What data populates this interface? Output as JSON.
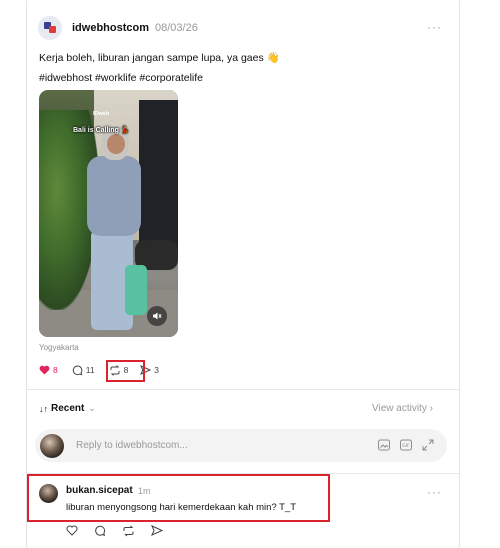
{
  "post": {
    "username": "idwebhostcom",
    "date": "08/03/26",
    "more_label": "···",
    "text_line1": "Kerja boleh, liburan jangan sampe lupa, ya gaes",
    "wave_emoji": "👋",
    "hashtags": "#idwebhost #worklife #corporatelife",
    "video": {
      "brand_watermark": "IDweb",
      "caption": "Bali is Calling 💃"
    },
    "location": "Yogyakarta",
    "stats": {
      "likes": "8",
      "comments": "11",
      "reposts": "8",
      "shares": "3"
    }
  },
  "replies_header": {
    "sort_label": "Recent",
    "sort_icon": "↓↑",
    "view_activity": "View activity ›"
  },
  "reply_bar": {
    "placeholder": "Reply to idwebhostcom..."
  },
  "comment": {
    "username": "bukan.sicepat",
    "time": "1m",
    "text": "liburan menyongsong hari kemerdekaan kah min? T_T",
    "more_label": "···"
  },
  "colors": {
    "like": "#e0245e",
    "highlight_box": "#d9232e",
    "muted": "#9a9a9a"
  }
}
